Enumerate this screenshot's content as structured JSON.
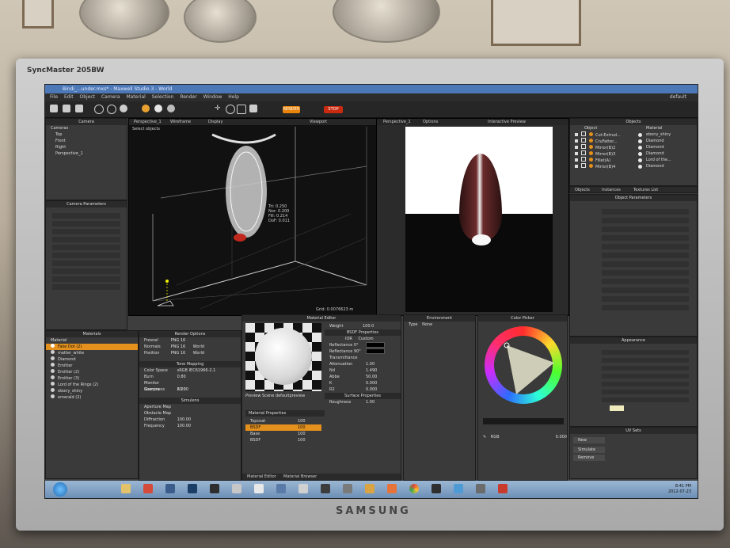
{
  "monitor": {
    "brand_top": "SyncMaster 205BW",
    "brand_bottom": "SAMSUNG"
  },
  "app": {
    "title": "Bindi_...under.mxs* - Maxwell Studio 3 - World",
    "workspace": "default"
  },
  "menu": [
    "File",
    "Edit",
    "Object",
    "Camera",
    "Material",
    "Selection",
    "Render",
    "Window",
    "Help"
  ],
  "toolbar": {
    "render_label": "RENDER",
    "stop_label": "STOP"
  },
  "camera_panel": {
    "title": "Camera",
    "items": [
      "Cameras",
      "Top",
      "Front",
      "Right",
      "Perspective_1"
    ]
  },
  "camera_params": {
    "title": "Camera Parameters"
  },
  "viewport": {
    "tab": "Perspective_1",
    "mode": "Wireframe",
    "display": "Display",
    "status": "Select objects",
    "view_label": "Viewport",
    "stats": [
      "Tri: 0.250",
      "Nor: 0.200",
      "Fill: 0.214",
      "DoF: 0.011"
    ],
    "grid": "Grid: 0.0076623 m"
  },
  "preview": {
    "tab": "Perspective_1",
    "options": "Options",
    "title": "Interactive Preview"
  },
  "objects_panel": {
    "title": "Objects",
    "col_object": "Object",
    "col_material": "Material",
    "items": [
      {
        "object": "Cut-Extrud...",
        "material": "ebony_shiny"
      },
      {
        "object": "CruFatter...",
        "material": "Diamond"
      },
      {
        "object": "Mirror(B)2",
        "material": "Diamond"
      },
      {
        "object": "Mirror(B)3",
        "material": "Diamond"
      },
      {
        "object": "Fillet(A)",
        "material": "Lord of the..."
      },
      {
        "object": "Mirror(B)4",
        "material": "Diamond"
      }
    ],
    "tabs": [
      "Objects",
      "Instances",
      "Textures List"
    ],
    "params_title": "Object Parameters"
  },
  "materials_panel": {
    "title": "Materials",
    "header": "Material",
    "items": [
      "Fake Dot (2)",
      "matter_white",
      "Diamond",
      "Emitter",
      "Emitter (2)",
      "Emitter (3)",
      "Lord of the Rings (2)",
      "ebony_shiny",
      "emerald (2)"
    ]
  },
  "render_options": {
    "title": "Render Options",
    "rows": [
      {
        "label": "Fresnel",
        "value": "PNG 16"
      },
      {
        "label": "Normals",
        "value": "PNG 16",
        "space": "World"
      },
      {
        "label": "Position",
        "value": "PNG 16",
        "space": "World"
      }
    ],
    "tone_title": "Tone Mapping",
    "color_space_label": "Color Space",
    "color_space": "sRGB IEC61966-2.1",
    "burn_label": "Burn",
    "burn": "0.80",
    "gamma_label": "Monitor Gamma",
    "gamma": "2.20",
    "sharp_label": "Sharpness",
    "sharp": "60.00",
    "sim_title": "Simulens",
    "aperture_label": "Aperture Map",
    "obstacle_label": "Obstacle Map",
    "diff_label": "Diffraction",
    "diff": "100.00",
    "freq_label": "Frequency",
    "freq": "100.00"
  },
  "material_editor": {
    "title": "Material Editor",
    "scene_label": "Preview Scene",
    "scene": "defaultpreview",
    "props_title": "Material Properties",
    "layers": [
      {
        "name": "Topcoat",
        "value": "100"
      },
      {
        "name": "BSDF",
        "value": "100"
      },
      {
        "name": "Base",
        "value": "100"
      },
      {
        "name": "BSDF",
        "value": "100"
      }
    ],
    "weight_label": "Weight",
    "weight": "100.0",
    "bsdf_title": "BSDF Properties",
    "ior_label": "IOR",
    "custom_label": "Custom",
    "refl0_label": "Reflectance 0°",
    "refl90_label": "Reflectance 90°",
    "trans_label": "Transmittance",
    "atten_label": "Attenuation",
    "atten": "1.00",
    "nd_label": "Nd",
    "nd": "1.490",
    "abbe_label": "Abbe",
    "abbe": "50.00",
    "k_label": "K",
    "k": "0.000",
    "r2_label": "R2",
    "r2": "0.000",
    "surface_title": "Surface Properties",
    "rough_label": "Roughness",
    "rough": "1.00",
    "footer_tabs": [
      "Material Editor",
      "Material Browser"
    ]
  },
  "environment": {
    "title": "Environment",
    "type_label": "Type",
    "type": "None"
  },
  "color_picker": {
    "title": "Color Picker",
    "rgb_label": "RGB",
    "value": "0.000"
  },
  "appearance": {
    "title": "Appearance"
  },
  "uv_sets": {
    "title": "UV Sets",
    "buttons": [
      "New",
      "Simulate",
      "Remove"
    ]
  },
  "taskbar": {
    "time": "8:41 PM",
    "date": "2012-07-23"
  },
  "colors": {
    "accent": "#e3901c",
    "stop": "#c92a10",
    "titlebar": "#4c78b8"
  }
}
